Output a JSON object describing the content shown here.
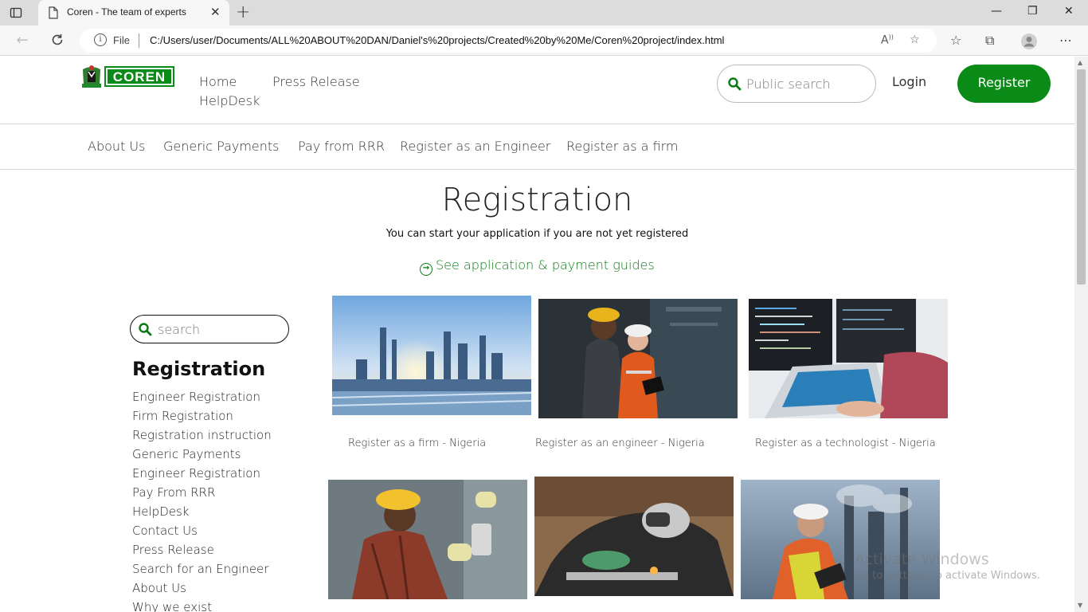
{
  "browser": {
    "tab_title": "Coren - The team of experts",
    "address_scheme": "File",
    "address_path": "C:/Users/user/Documents/ALL%20ABOUT%20DAN/Daniel's%20projects/Created%20by%20Me/Coren%20project/index.html"
  },
  "header": {
    "logo_text": "COREN",
    "nav": [
      "Home",
      "Press Release",
      "HelpDesk"
    ],
    "search_placeholder": "Public search",
    "login": "Login",
    "register": "Register"
  },
  "subnav": [
    "About Us",
    "Generic Payments",
    "Pay from RRR",
    "Register as an Engineer",
    "Register as a firm"
  ],
  "main": {
    "title": "Registration",
    "subtitle": "You can start your application if you are not yet registered",
    "guides_link": "See application & payment guides"
  },
  "sidebar": {
    "search_placeholder": "search",
    "title": "Registration",
    "items": [
      "Engineer Registration",
      "Firm Registration",
      "Registration instruction",
      "Generic Payments",
      "Engineer Registration",
      "Pay From RRR",
      "HelpDesk",
      "Contact Us",
      "Press Release",
      "Search for an Engineer",
      "About Us",
      "Why we exist"
    ]
  },
  "cards": [
    {
      "caption": "Register as a firm - Nigeria",
      "image": "refinery-photo"
    },
    {
      "caption": "Register as an engineer - Nigeria",
      "image": "engineers-factory-photo"
    },
    {
      "caption": "Register as a technologist - Nigeria",
      "image": "laptop-code-photo"
    },
    {
      "caption": "",
      "image": "electrician-photo"
    },
    {
      "caption": "",
      "image": "welder-photo"
    },
    {
      "caption": "",
      "image": "engineer-tablet-photo"
    }
  ],
  "watermark": {
    "line1": "Activate Windows",
    "line2": "Go to Settings to activate Windows."
  },
  "colors": {
    "brand_green": "#0a8a16",
    "link_green": "#0a7a14"
  }
}
